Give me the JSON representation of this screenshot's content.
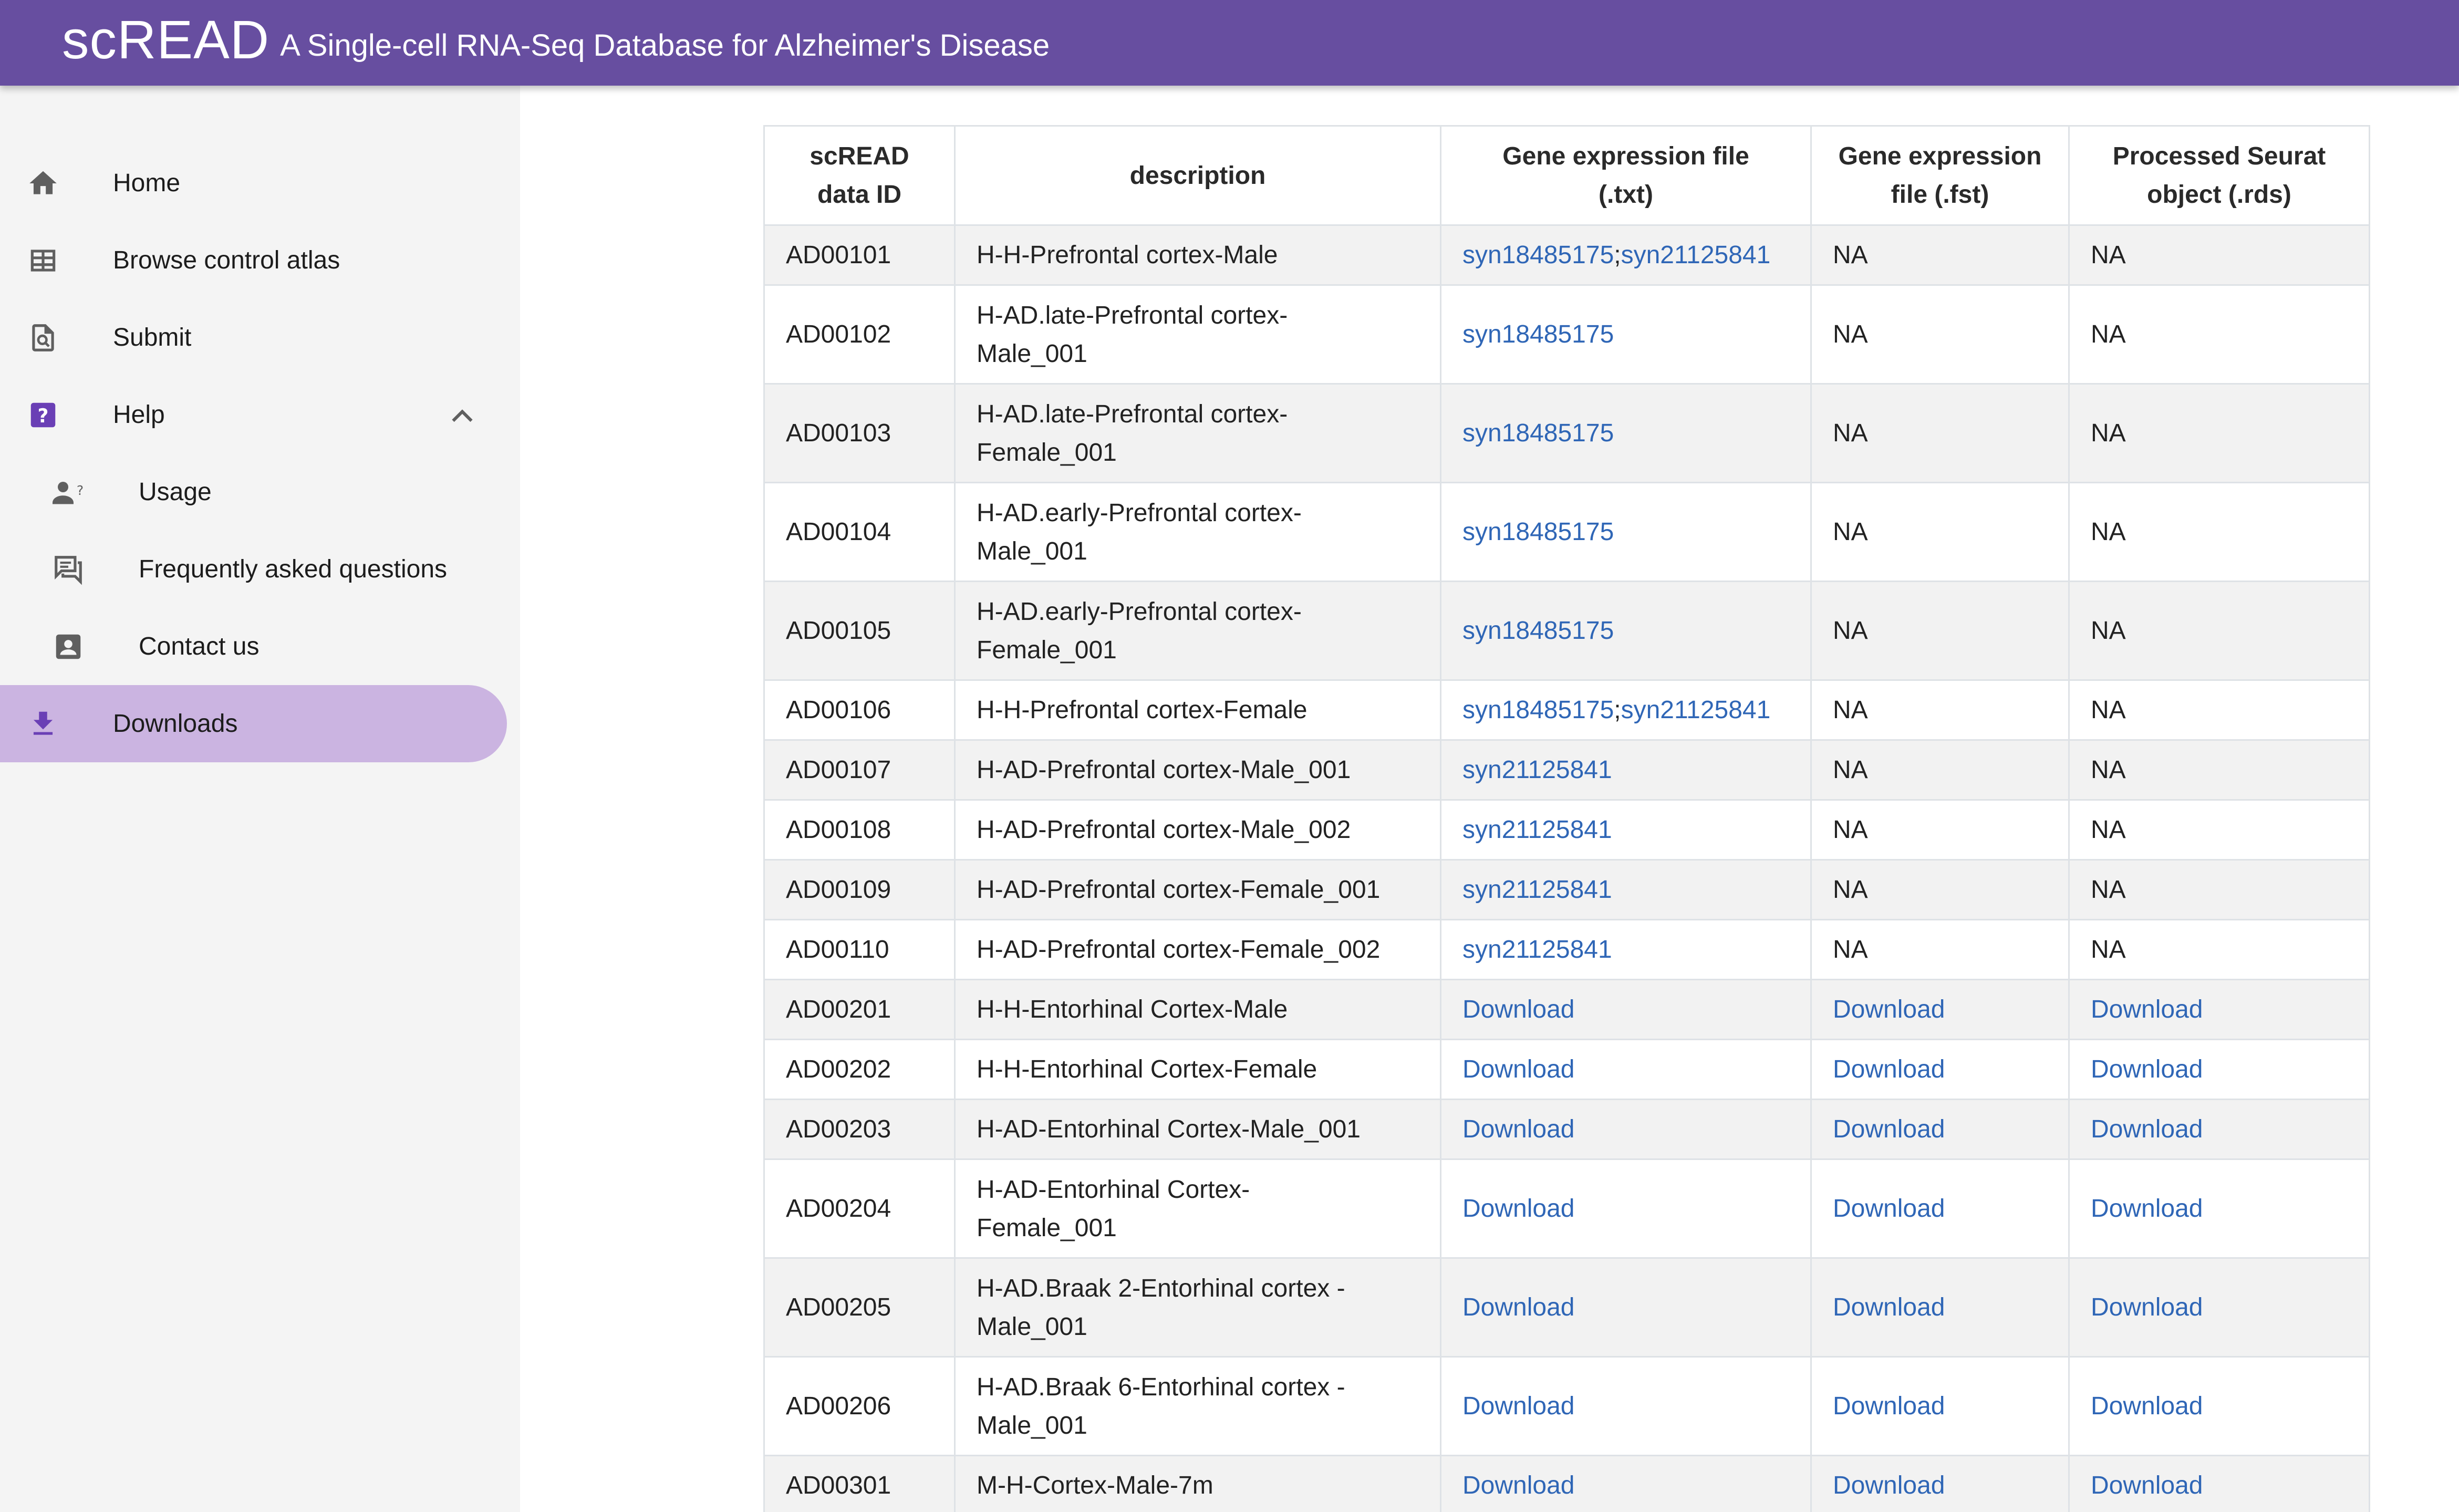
{
  "app": {
    "brand": "scREAD",
    "tagline": "A Single-cell RNA-Seq Database for Alzheimer's Disease"
  },
  "sidebar": {
    "items": [
      {
        "label": "Home",
        "icon": "home-icon"
      },
      {
        "label": "Browse control atlas",
        "icon": "table-icon"
      },
      {
        "label": "Submit",
        "icon": "find-in-page-icon"
      },
      {
        "label": "Help",
        "icon": "help-icon",
        "expanded": true
      },
      {
        "label": "Usage",
        "icon": "person-question-icon"
      },
      {
        "label": "Frequently asked questions",
        "icon": "forum-icon"
      },
      {
        "label": "Contact us",
        "icon": "contact-card-icon"
      },
      {
        "label": "Downloads",
        "icon": "download-icon",
        "active": true
      }
    ]
  },
  "colors": {
    "appbar": "#674ea0",
    "active_nav": "#cbb4e1",
    "link": "#2f66b6",
    "help_icon": "#6a3fb5"
  },
  "table": {
    "headers": [
      [
        "scREAD",
        "data ID"
      ],
      [
        "description"
      ],
      [
        "Gene expression file",
        "(.txt)"
      ],
      [
        "Gene expression",
        "file (.fst)"
      ],
      [
        "Processed Seurat",
        "object (.rds)"
      ]
    ],
    "rows": [
      {
        "id": "AD00101",
        "desc": [
          "H-H-Prefrontal cortex-Male"
        ],
        "txt": [
          "syn18485175",
          "syn21125841"
        ],
        "fst": "NA",
        "rds": "NA"
      },
      {
        "id": "AD00102",
        "desc": [
          "H-AD.late-Prefrontal cortex-",
          "Male_001"
        ],
        "txt": [
          "syn18485175"
        ],
        "fst": "NA",
        "rds": "NA"
      },
      {
        "id": "AD00103",
        "desc": [
          "H-AD.late-Prefrontal cortex-",
          "Female_001"
        ],
        "txt": [
          "syn18485175"
        ],
        "fst": "NA",
        "rds": "NA"
      },
      {
        "id": "AD00104",
        "desc": [
          "H-AD.early-Prefrontal cortex-",
          "Male_001"
        ],
        "txt": [
          "syn18485175"
        ],
        "fst": "NA",
        "rds": "NA"
      },
      {
        "id": "AD00105",
        "desc": [
          "H-AD.early-Prefrontal cortex-",
          "Female_001"
        ],
        "txt": [
          "syn18485175"
        ],
        "fst": "NA",
        "rds": "NA"
      },
      {
        "id": "AD00106",
        "desc": [
          "H-H-Prefrontal cortex-Female"
        ],
        "txt": [
          "syn18485175",
          "syn21125841"
        ],
        "fst": "NA",
        "rds": "NA"
      },
      {
        "id": "AD00107",
        "desc": [
          "H-AD-Prefrontal cortex-Male_001"
        ],
        "txt": [
          "syn21125841"
        ],
        "fst": "NA",
        "rds": "NA"
      },
      {
        "id": "AD00108",
        "desc": [
          "H-AD-Prefrontal cortex-Male_002"
        ],
        "txt": [
          "syn21125841"
        ],
        "fst": "NA",
        "rds": "NA"
      },
      {
        "id": "AD00109",
        "desc": [
          "H-AD-Prefrontal cortex-Female_001"
        ],
        "txt": [
          "syn21125841"
        ],
        "fst": "NA",
        "rds": "NA"
      },
      {
        "id": "AD00110",
        "desc": [
          "H-AD-Prefrontal cortex-Female_002"
        ],
        "txt": [
          "syn21125841"
        ],
        "fst": "NA",
        "rds": "NA"
      },
      {
        "id": "AD00201",
        "desc": [
          "H-H-Entorhinal Cortex-Male"
        ],
        "txt": [
          "Download"
        ],
        "fst": "Download",
        "rds": "Download"
      },
      {
        "id": "AD00202",
        "desc": [
          "H-H-Entorhinal Cortex-Female"
        ],
        "txt": [
          "Download"
        ],
        "fst": "Download",
        "rds": "Download"
      },
      {
        "id": "AD00203",
        "desc": [
          "H-AD-Entorhinal Cortex-Male_001"
        ],
        "txt": [
          "Download"
        ],
        "fst": "Download",
        "rds": "Download"
      },
      {
        "id": "AD00204",
        "desc": [
          "H-AD-Entorhinal Cortex-",
          "Female_001"
        ],
        "txt": [
          "Download"
        ],
        "fst": "Download",
        "rds": "Download"
      },
      {
        "id": "AD00205",
        "desc": [
          "H-AD.Braak 2-Entorhinal cortex -",
          "Male_001"
        ],
        "txt": [
          "Download"
        ],
        "fst": "Download",
        "rds": "Download"
      },
      {
        "id": "AD00206",
        "desc": [
          "H-AD.Braak 6-Entorhinal cortex -",
          "Male_001"
        ],
        "txt": [
          "Download"
        ],
        "fst": "Download",
        "rds": "Download"
      },
      {
        "id": "AD00301",
        "desc": [
          "M-H-Cortex-Male-7m"
        ],
        "txt": [
          "Download"
        ],
        "fst": "Download",
        "rds": "Download"
      }
    ]
  }
}
